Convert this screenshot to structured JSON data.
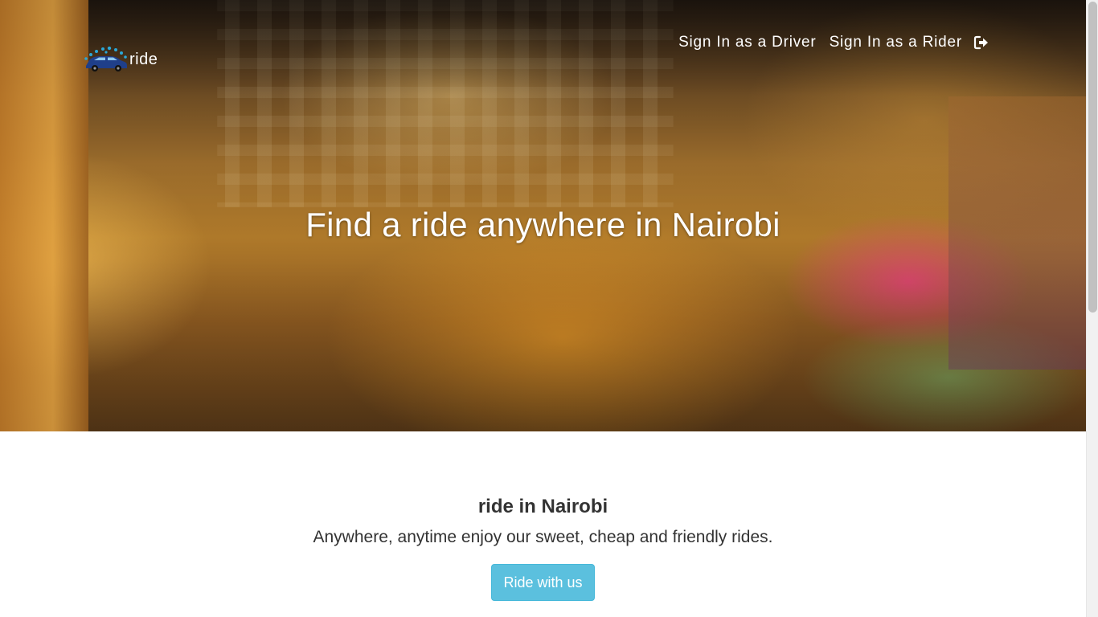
{
  "brand": {
    "text": "ride",
    "logo_icon": "car-logo-icon"
  },
  "nav": {
    "driver_signin": "Sign In as a Driver",
    "rider_signin": "Sign In as a Rider",
    "logout_icon": "sign-out-icon"
  },
  "hero": {
    "title": "Find a ride anywhere in Nairobi"
  },
  "about": {
    "title": "ride in Nairobi",
    "subtitle": "Anywhere, anytime enjoy our sweet, cheap and friendly rides.",
    "cta_label": "Ride with us"
  },
  "colors": {
    "accent": "#5bc0de",
    "text": "#333333",
    "nav_text": "#ffffff"
  }
}
